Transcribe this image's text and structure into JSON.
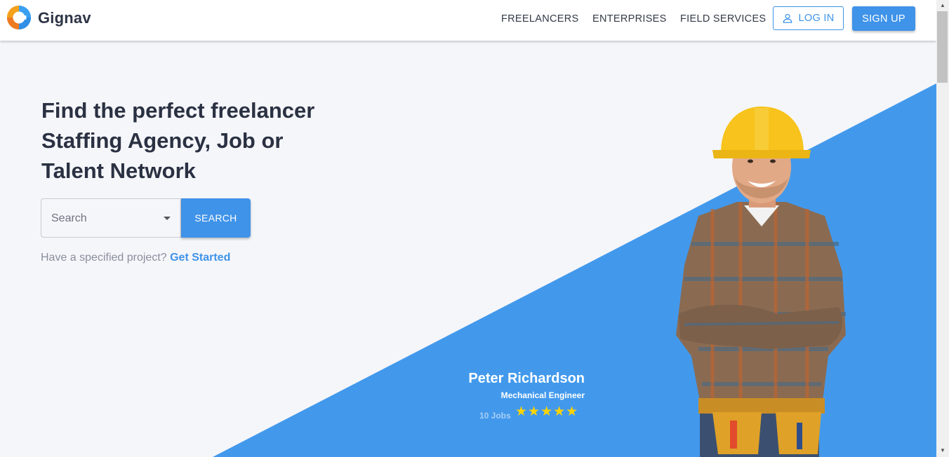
{
  "brand": {
    "name": "Gignav"
  },
  "nav": {
    "links": [
      "FREELANCERS",
      "ENTERPRISES",
      "FIELD SERVICES"
    ],
    "login_label": "LOG IN",
    "signup_label": "SIGN UP"
  },
  "hero": {
    "headline_lines": [
      "Find the perfect freelancer",
      "Staffing Agency, Job or",
      "Talent Network"
    ],
    "search": {
      "placeholder": "Search",
      "button_label": "SEARCH"
    },
    "project_prompt": "Have a specified project?",
    "project_link": "Get Started"
  },
  "profile": {
    "name": "Peter Richardson",
    "title": "Mechanical Engineer",
    "jobs": "10 Jobs",
    "rating": 5,
    "stars": "★★★★★"
  },
  "icons": {
    "logo": "gignav-logo-icon",
    "user": "user-icon",
    "caret": "caret-down-icon",
    "star": "star-icon"
  },
  "colors": {
    "accent": "#3f93e8",
    "triangle": "#4299ec",
    "star": "#ffd400",
    "background": "#f5f6fa"
  }
}
